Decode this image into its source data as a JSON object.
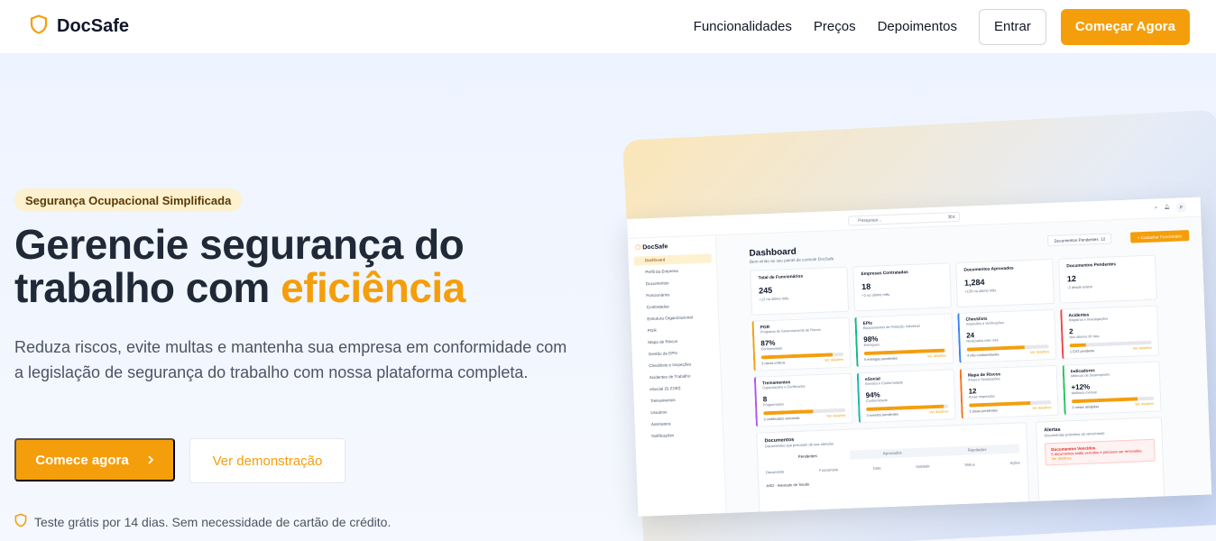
{
  "nav": {
    "brand": "DocSafe",
    "links": [
      "Funcionalidades",
      "Preços",
      "Depoimentos"
    ],
    "login": "Entrar",
    "start": "Começar Agora"
  },
  "hero": {
    "badge": "Segurança Ocupacional Simplificada",
    "title_line1": "Gerencie segurança do",
    "title_line2_prefix": "trabalho com ",
    "title_accent": "eficiência",
    "lead": "Reduza riscos, evite multas e mantenha sua empresa em conformidade com a legislação de segurança do trabalho com nossa plataforma completa.",
    "cta_primary": "Comece agora",
    "cta_secondary": "Ver demonstração",
    "trial_note": "Teste grátis por 14 dias. Sem necessidade de cartão de crédito.",
    "accent_color": "#f59e0b"
  },
  "mockup": {
    "brand": "DocSafe",
    "search_placeholder": "Pesquisar...",
    "search_shortcut": "⌘K",
    "avatar": "P",
    "sidebar": [
      "Dashboard",
      "Perfil da Empresa",
      "Documentos",
      "Funcionários",
      "Contratadas",
      "Estrutura Organizacional",
      "PGR",
      "Mapa de Riscos",
      "Gestão de EPIs",
      "Checklists e Inspeções",
      "Acidentes de Trabalho",
      "eSocial (S-2240)",
      "Treinamentos",
      "Usuários",
      "Assinatura",
      "Notificações"
    ],
    "title": "Dashboard",
    "subtitle": "Bem-vindo ao seu painel de controle DocSafe",
    "pending_btn": "Documentos Pendentes",
    "pending_count": "12",
    "new_btn": "+ Cadastrar Funcionário",
    "stats": [
      {
        "title": "Total de Funcionários",
        "value": "245",
        "sub": "+12 no último mês"
      },
      {
        "title": "Empresas Contratadas",
        "value": "18",
        "sub": "+2 no último mês"
      },
      {
        "title": "Documentos Aprovados",
        "value": "1,284",
        "sub": "+156 no último mês"
      },
      {
        "title": "Documentos Pendentes",
        "value": "12",
        "sub": "-3 desde ontem"
      }
    ],
    "modules": [
      {
        "title": "PGR",
        "desc": "Programa de Gerenciamento de Riscos",
        "value": "87%",
        "label": "Conformidade",
        "progress": 0.87,
        "foot": "3 riscos críticos",
        "link": "Ver detalhes",
        "color": "#f59e0b"
      },
      {
        "title": "EPIs",
        "desc": "Equipamentos de Proteção Individual",
        "value": "98%",
        "label": "Entregues",
        "progress": 0.98,
        "foot": "5 entregas pendentes",
        "link": "Ver detalhes",
        "color": "#10b981"
      },
      {
        "title": "Checklists",
        "desc": "Inspeções e Verificações",
        "value": "24",
        "label": "Realizados este mês",
        "progress": 0.7,
        "foot": "4 não conformidades",
        "link": "Ver detalhes",
        "color": "#3b82f6"
      },
      {
        "title": "Acidentes",
        "desc": "Registros e Investigações",
        "value": "2",
        "label": "Nos últimos 30 dias",
        "progress": 0.2,
        "foot": "1 CAT pendente",
        "link": "Ver detalhes",
        "color": "#ef4444"
      },
      {
        "title": "Treinamentos",
        "desc": "Capacitações e Certificados",
        "value": "8",
        "label": "Programados",
        "progress": 0.6,
        "foot": "3 certificados vencendo",
        "link": "Ver detalhes",
        "color": "#a855f7"
      },
      {
        "title": "eSocial",
        "desc": "Eventos e Conformidade",
        "value": "94%",
        "label": "Conformidade",
        "progress": 0.94,
        "foot": "3 eventos pendentes",
        "link": "Ver detalhes",
        "color": "#14b8a6"
      },
      {
        "title": "Mapa de Riscos",
        "desc": "Áreas e Sinalizações",
        "value": "12",
        "label": "Áreas mapeadas",
        "progress": 0.75,
        "foot": "2 áreas pendentes",
        "link": "Ver detalhes",
        "color": "#f97316"
      },
      {
        "title": "Indicadores",
        "desc": "Métricas de Desempenho",
        "value": "+12%",
        "label": "Melhoria mensal",
        "progress": 0.8,
        "foot": "3 metas atingidas",
        "link": "Ver detalhes",
        "color": "#22c55e"
      }
    ],
    "docs": {
      "title": "Documentos",
      "desc": "Documentos que precisam de sua atenção",
      "tabs": [
        "Pendentes",
        "Aprovados",
        "Rejeitados"
      ],
      "cols": [
        "Documento",
        "Funcionário",
        "Data",
        "Validade",
        "Status",
        "Ações"
      ],
      "row": "ASO - Atestado de Saúde"
    },
    "alerts": {
      "title": "Alertas",
      "desc": "Documentos próximos do vencimento",
      "alert_title": "Documentos Vencidos",
      "alert_body": "5 documentos estão vencidos e precisam ser renovados.",
      "alert_link": "Ver detalhes"
    }
  }
}
